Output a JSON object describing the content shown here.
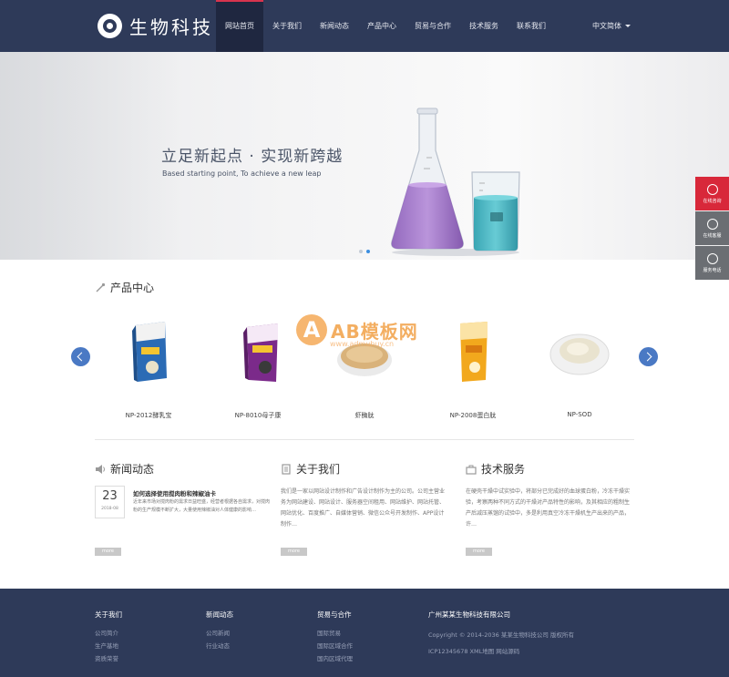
{
  "header": {
    "brand": "生物科技",
    "nav": [
      "网站首页",
      "关于我们",
      "新闻动态",
      "产品中心",
      "贸易与合作",
      "技术服务",
      "联系我们"
    ],
    "active_index": 0,
    "language": "中文简体"
  },
  "banner": {
    "title": "立足新起点 · 实现新跨越",
    "subtitle": "Based starting point, To achieve a new leap",
    "slide_count": 2,
    "current_slide": 2
  },
  "side_tools": [
    "在线咨询",
    "在线客服",
    "服务电话"
  ],
  "products": {
    "title": "产品中心",
    "items": [
      "NP-2012酵乳宝",
      "NP-8010母子康",
      "虾酶肽",
      "NP-2008蛋白肽",
      "NP-SOD"
    ]
  },
  "watermark": {
    "letter": "A",
    "text": "AB模板网",
    "url": "www.admubuy.cn"
  },
  "news": {
    "title": "新闻动态",
    "day": "23",
    "year_month": "2018-08",
    "headline": "如何选择使用搅肉粉和辣椒油卡",
    "body": "近年来市场对搅肉粉的需求日益旺盛，经营者根据各自需求，对搅肉粉的生产规模不断扩大，大量使用辣椒油对人体健康的影响…",
    "more": "more"
  },
  "about": {
    "title": "关于我们",
    "body": "我们是一家以网站设计制作和广告设计制作为主的公司。公司主营业务为网站建设、网站设计、服务器空间租用、网站维护、网站托管、网站优化、百度推广、自媒体营销、微信公众号开发制作、APP设计制作…",
    "more": "more"
  },
  "tech": {
    "title": "技术服务",
    "body": "在硬壳干燥中试实验中，将部分已完成好的血球蛋白粉，冷冻干燥实验，考察两种不同方式的干燥对产品特性的影响，及其相应的粗制生产后减压蒸馏的试验中，多是利用真空冷冻干燥机生产出来的产品，许…",
    "more": "more"
  },
  "footer": {
    "columns": [
      {
        "title": "关于我们",
        "links": [
          "公司简介",
          "生产基地",
          "资质荣誉"
        ]
      },
      {
        "title": "新闻动态",
        "links": [
          "公司新闻",
          "行业动态"
        ]
      },
      {
        "title": "贸易与合作",
        "links": [
          "国际贸易",
          "国际区域合作",
          "国内区域代理"
        ]
      }
    ],
    "company": "广州某某生物科技有限公司",
    "copyright": "Copyright © 2014-2036 某某生物科技公司 版权所有",
    "icp": "ICP12345678  XML地图  网站源码"
  },
  "colors": {
    "header_bg": "#2e3a59",
    "accent_red": "#d8344e",
    "arrow_blue": "#4a79c4"
  }
}
